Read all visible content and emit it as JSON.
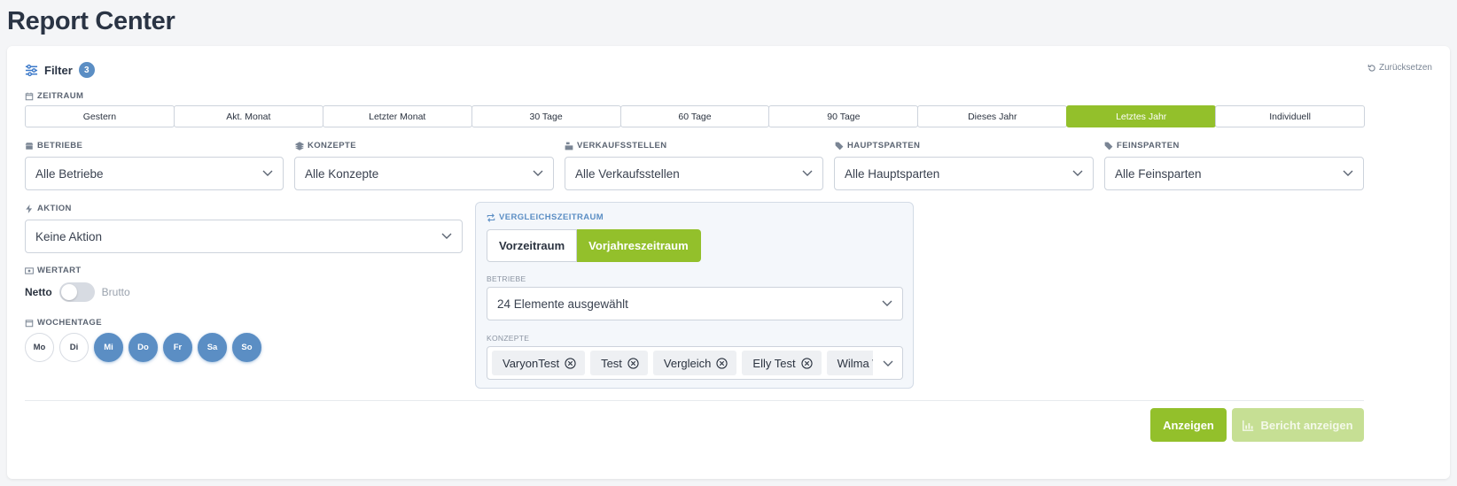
{
  "page": {
    "title": "Report Center"
  },
  "filter": {
    "title": "Filter",
    "count": "3",
    "reset_label": "Zurücksetzen",
    "zeitraum": {
      "label": "ZEITRAUM",
      "options": [
        "Gestern",
        "Akt. Monat",
        "Letzter Monat",
        "30 Tage",
        "60 Tage",
        "90 Tage",
        "Dieses Jahr",
        "Letztes Jahr",
        "Individuell"
      ],
      "selected": "Letztes Jahr"
    },
    "selects": [
      {
        "label": "BETRIEBE",
        "value": "Alle Betriebe",
        "icon": "store-icon"
      },
      {
        "label": "KONZEPTE",
        "value": "Alle Konzepte",
        "icon": "layers-icon"
      },
      {
        "label": "VERKAUFSSTELLEN",
        "value": "Alle Verkaufsstellen",
        "icon": "cash-register-icon"
      },
      {
        "label": "HAUPTSPARTEN",
        "value": "Alle Hauptsparten",
        "icon": "tags-icon"
      },
      {
        "label": "FEINSPARTEN",
        "value": "Alle Feinsparten",
        "icon": "tag-icon"
      }
    ],
    "aktion": {
      "label": "AKTION",
      "value": "Keine Aktion"
    },
    "wertart": {
      "label": "WERTART",
      "left": "Netto",
      "right": "Brutto",
      "on": false
    },
    "wochentage": {
      "label": "WOCHENTAGE",
      "days": [
        {
          "label": "Mo",
          "on": false
        },
        {
          "label": "Di",
          "on": false
        },
        {
          "label": "Mi",
          "on": true
        },
        {
          "label": "Do",
          "on": true
        },
        {
          "label": "Fr",
          "on": true
        },
        {
          "label": "Sa",
          "on": true
        },
        {
          "label": "So",
          "on": true
        }
      ]
    },
    "vergleich": {
      "label": "VERGLEICHSZEITRAUM",
      "options": [
        "Vorzeitraum",
        "Vorjahreszeitraum"
      ],
      "selected": "Vorjahreszeitraum",
      "betriebe_label": "BETRIEBE",
      "betriebe_value": "24 Elemente ausgewählt",
      "konzepte_label": "KONZEPTE",
      "konzepte_chips": [
        "VaryonTest",
        "Test",
        "Vergleich",
        "Elly Test",
        "Wilma W"
      ]
    },
    "actions": {
      "show": "Anzeigen",
      "report": "Bericht anzeigen"
    },
    "colors": {
      "accent_green": "#93c02b",
      "accent_blue": "#5b8ec4"
    }
  }
}
